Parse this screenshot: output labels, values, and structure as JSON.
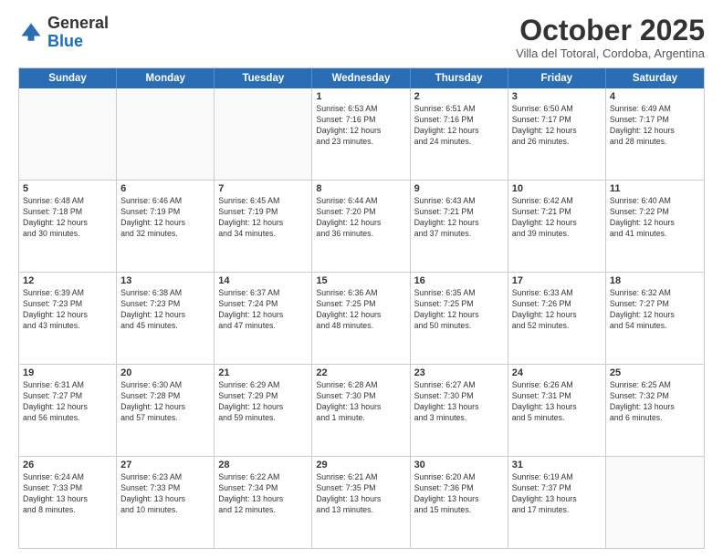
{
  "header": {
    "logo_general": "General",
    "logo_blue": "Blue",
    "month_title": "October 2025",
    "subtitle": "Villa del Totoral, Cordoba, Argentina"
  },
  "weekdays": [
    "Sunday",
    "Monday",
    "Tuesday",
    "Wednesday",
    "Thursday",
    "Friday",
    "Saturday"
  ],
  "rows": [
    [
      {
        "day": "",
        "text": ""
      },
      {
        "day": "",
        "text": ""
      },
      {
        "day": "",
        "text": ""
      },
      {
        "day": "1",
        "text": "Sunrise: 6:53 AM\nSunset: 7:16 PM\nDaylight: 12 hours\nand 23 minutes."
      },
      {
        "day": "2",
        "text": "Sunrise: 6:51 AM\nSunset: 7:16 PM\nDaylight: 12 hours\nand 24 minutes."
      },
      {
        "day": "3",
        "text": "Sunrise: 6:50 AM\nSunset: 7:17 PM\nDaylight: 12 hours\nand 26 minutes."
      },
      {
        "day": "4",
        "text": "Sunrise: 6:49 AM\nSunset: 7:17 PM\nDaylight: 12 hours\nand 28 minutes."
      }
    ],
    [
      {
        "day": "5",
        "text": "Sunrise: 6:48 AM\nSunset: 7:18 PM\nDaylight: 12 hours\nand 30 minutes."
      },
      {
        "day": "6",
        "text": "Sunrise: 6:46 AM\nSunset: 7:19 PM\nDaylight: 12 hours\nand 32 minutes."
      },
      {
        "day": "7",
        "text": "Sunrise: 6:45 AM\nSunset: 7:19 PM\nDaylight: 12 hours\nand 34 minutes."
      },
      {
        "day": "8",
        "text": "Sunrise: 6:44 AM\nSunset: 7:20 PM\nDaylight: 12 hours\nand 36 minutes."
      },
      {
        "day": "9",
        "text": "Sunrise: 6:43 AM\nSunset: 7:21 PM\nDaylight: 12 hours\nand 37 minutes."
      },
      {
        "day": "10",
        "text": "Sunrise: 6:42 AM\nSunset: 7:21 PM\nDaylight: 12 hours\nand 39 minutes."
      },
      {
        "day": "11",
        "text": "Sunrise: 6:40 AM\nSunset: 7:22 PM\nDaylight: 12 hours\nand 41 minutes."
      }
    ],
    [
      {
        "day": "12",
        "text": "Sunrise: 6:39 AM\nSunset: 7:23 PM\nDaylight: 12 hours\nand 43 minutes."
      },
      {
        "day": "13",
        "text": "Sunrise: 6:38 AM\nSunset: 7:23 PM\nDaylight: 12 hours\nand 45 minutes."
      },
      {
        "day": "14",
        "text": "Sunrise: 6:37 AM\nSunset: 7:24 PM\nDaylight: 12 hours\nand 47 minutes."
      },
      {
        "day": "15",
        "text": "Sunrise: 6:36 AM\nSunset: 7:25 PM\nDaylight: 12 hours\nand 48 minutes."
      },
      {
        "day": "16",
        "text": "Sunrise: 6:35 AM\nSunset: 7:25 PM\nDaylight: 12 hours\nand 50 minutes."
      },
      {
        "day": "17",
        "text": "Sunrise: 6:33 AM\nSunset: 7:26 PM\nDaylight: 12 hours\nand 52 minutes."
      },
      {
        "day": "18",
        "text": "Sunrise: 6:32 AM\nSunset: 7:27 PM\nDaylight: 12 hours\nand 54 minutes."
      }
    ],
    [
      {
        "day": "19",
        "text": "Sunrise: 6:31 AM\nSunset: 7:27 PM\nDaylight: 12 hours\nand 56 minutes."
      },
      {
        "day": "20",
        "text": "Sunrise: 6:30 AM\nSunset: 7:28 PM\nDaylight: 12 hours\nand 57 minutes."
      },
      {
        "day": "21",
        "text": "Sunrise: 6:29 AM\nSunset: 7:29 PM\nDaylight: 12 hours\nand 59 minutes."
      },
      {
        "day": "22",
        "text": "Sunrise: 6:28 AM\nSunset: 7:30 PM\nDaylight: 13 hours\nand 1 minute."
      },
      {
        "day": "23",
        "text": "Sunrise: 6:27 AM\nSunset: 7:30 PM\nDaylight: 13 hours\nand 3 minutes."
      },
      {
        "day": "24",
        "text": "Sunrise: 6:26 AM\nSunset: 7:31 PM\nDaylight: 13 hours\nand 5 minutes."
      },
      {
        "day": "25",
        "text": "Sunrise: 6:25 AM\nSunset: 7:32 PM\nDaylight: 13 hours\nand 6 minutes."
      }
    ],
    [
      {
        "day": "26",
        "text": "Sunrise: 6:24 AM\nSunset: 7:33 PM\nDaylight: 13 hours\nand 8 minutes."
      },
      {
        "day": "27",
        "text": "Sunrise: 6:23 AM\nSunset: 7:33 PM\nDaylight: 13 hours\nand 10 minutes."
      },
      {
        "day": "28",
        "text": "Sunrise: 6:22 AM\nSunset: 7:34 PM\nDaylight: 13 hours\nand 12 minutes."
      },
      {
        "day": "29",
        "text": "Sunrise: 6:21 AM\nSunset: 7:35 PM\nDaylight: 13 hours\nand 13 minutes."
      },
      {
        "day": "30",
        "text": "Sunrise: 6:20 AM\nSunset: 7:36 PM\nDaylight: 13 hours\nand 15 minutes."
      },
      {
        "day": "31",
        "text": "Sunrise: 6:19 AM\nSunset: 7:37 PM\nDaylight: 13 hours\nand 17 minutes."
      },
      {
        "day": "",
        "text": ""
      }
    ]
  ]
}
